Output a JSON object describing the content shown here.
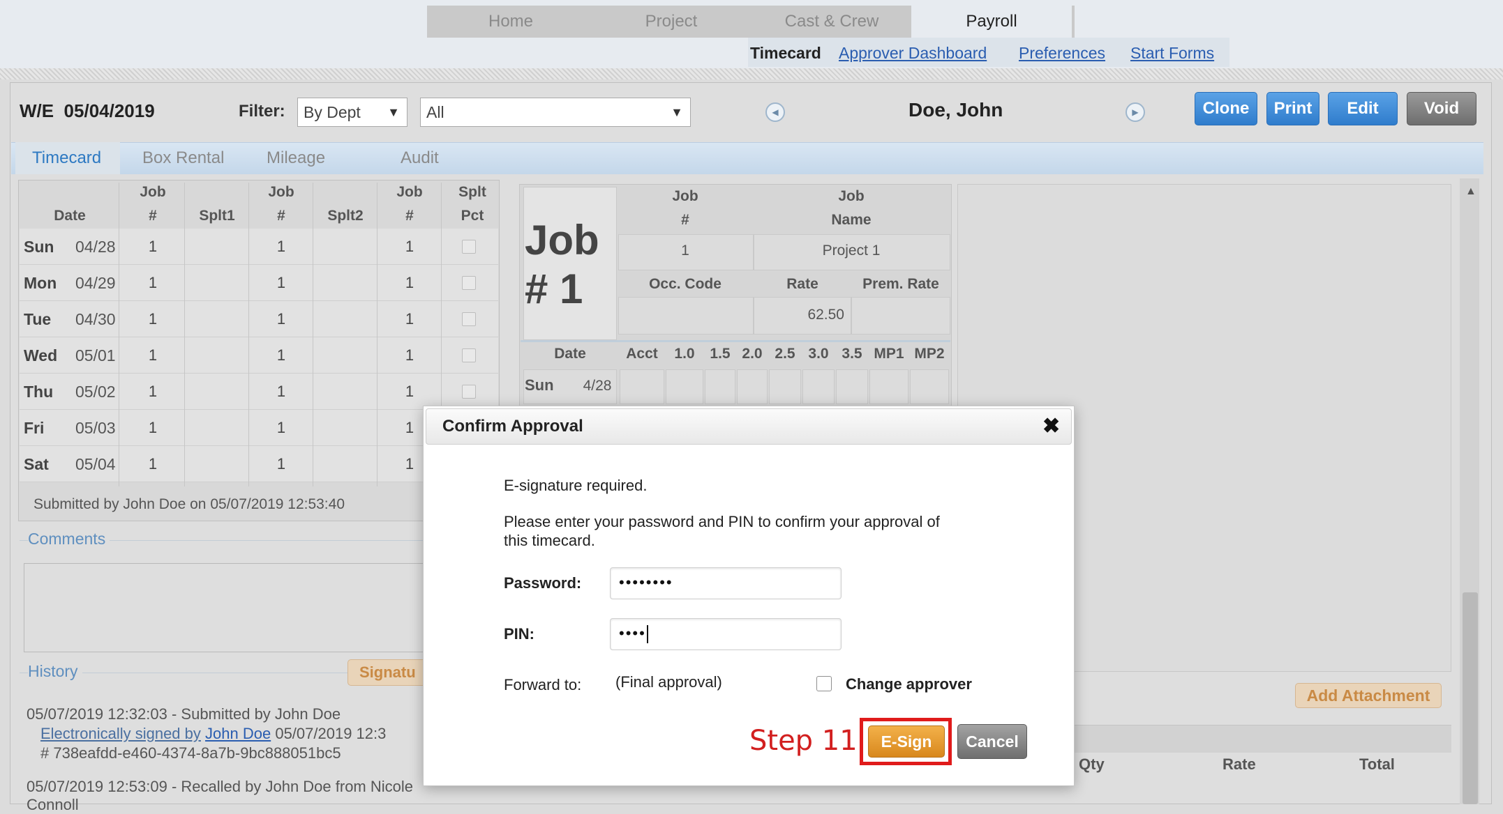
{
  "nav": {
    "tabs": [
      "Home",
      "Project",
      "Cast & Crew",
      "Payroll"
    ],
    "active_tab": "Payroll",
    "sub": {
      "current": "Timecard",
      "links": [
        "Approver Dashboard",
        "Preferences",
        "Start Forms"
      ]
    }
  },
  "header": {
    "week_ending": "W/E  05/04/2019",
    "filter_label": "Filter:",
    "filter_value": "By Dept",
    "filter_scope": "All",
    "employee": "Doe, John",
    "buttons": {
      "clone": "Clone",
      "print": "Print",
      "edit": "Edit",
      "void": "Void"
    },
    "arrow_glyph": "▼",
    "prev_glyph": "◀",
    "next_glyph": "▶"
  },
  "subtabs": [
    "Timecard",
    "Box Rental",
    "Mileage",
    "Audit"
  ],
  "timecard": {
    "head_top": [
      "Job",
      "Job",
      "Job",
      "Splt"
    ],
    "head_bottom": [
      "Date",
      "#",
      "Splt1",
      "#",
      "Splt2",
      "#",
      "Pct"
    ],
    "rows": [
      {
        "day": "Sun",
        "date": "04/28",
        "job1": "1",
        "job2": "1",
        "job3": "1"
      },
      {
        "day": "Mon",
        "date": "04/29",
        "job1": "1",
        "job2": "1",
        "job3": "1"
      },
      {
        "day": "Tue",
        "date": "04/30",
        "job1": "1",
        "job2": "1",
        "job3": "1"
      },
      {
        "day": "Wed",
        "date": "05/01",
        "job1": "1",
        "job2": "1",
        "job3": "1"
      },
      {
        "day": "Thu",
        "date": "05/02",
        "job1": "1",
        "job2": "1",
        "job3": "1"
      },
      {
        "day": "Fri",
        "date": "05/03",
        "job1": "1",
        "job2": "1",
        "job3": "1"
      },
      {
        "day": "Sat",
        "date": "05/04",
        "job1": "1",
        "job2": "1",
        "job3": "1"
      }
    ],
    "submitted": "Submitted by John Doe on 05/07/2019 12:53:40"
  },
  "comments": {
    "label": "Comments"
  },
  "history": {
    "label": "History",
    "signature_button": "Signatu",
    "line1": "05/07/2019 12:32:03 - Submitted by John Doe",
    "line2_link": "Electronically signed by",
    "line2_name": "John Doe",
    "line2_rest": " 05/07/2019 12:3",
    "line3": "# 738eafdd-e460-4374-8a7b-9bc888051bc5",
    "line4": "05/07/2019 12:53:09 - Recalled by John Doe from Nicole",
    "line5": "Connoll"
  },
  "job": {
    "big_label_1": "Job",
    "big_label_2": "# 1",
    "h_job": "Job",
    "h_num": "#",
    "h_job2": "Job",
    "h_name": "Name",
    "job_num": "1",
    "job_name": "Project 1",
    "h_occ": "Occ. Code",
    "h_rate": "Rate",
    "h_prem": "Prem. Rate",
    "rate": "62.50",
    "date_cols": [
      "Date",
      "Acct",
      "1.0",
      "1.5",
      "2.0",
      "2.5",
      "3.0",
      "3.5",
      "MP1",
      "MP2"
    ],
    "first_day": "Sun",
    "first_date": "4/28"
  },
  "attachments": {
    "add_button": "Add Attachment",
    "cols": [
      "Qty",
      "Rate",
      "Total"
    ]
  },
  "modal": {
    "title": "Confirm Approval",
    "close_glyph": "✖",
    "esig_required": "E-signature required.",
    "instructions_1": "Please enter your password and PIN to confirm your approval of",
    "instructions_2": "this timecard.",
    "password_label": "Password:",
    "password_value": "••••••••",
    "pin_label": "PIN:",
    "pin_value": "••••",
    "forward_label": "Forward to:",
    "forward_value": "(Final approval)",
    "change_approver": "Change approver",
    "step_label": "Step 11",
    "esign_button": "E-Sign",
    "cancel_button": "Cancel"
  },
  "colors": {
    "accent": "#2f7ccc",
    "highlight": "#e01b1b",
    "esign": "#d8881d"
  }
}
